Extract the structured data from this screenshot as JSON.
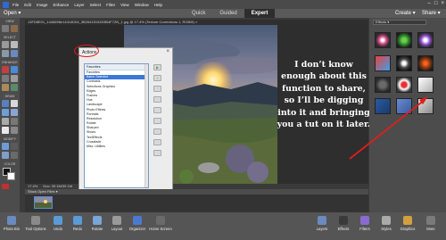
{
  "menubar": {
    "items": [
      "File",
      "Edit",
      "Image",
      "Enhance",
      "Layer",
      "Select",
      "Filter",
      "View",
      "Window",
      "Help"
    ],
    "window_controls": [
      "–",
      "□",
      "×"
    ]
  },
  "modebar": {
    "open_label": "Open ▾",
    "tabs": [
      "Quick",
      "Guided",
      "Expert"
    ],
    "active_tab": "Expert",
    "create_label": "Create ▾",
    "share_label": "Share ▾"
  },
  "tools": {
    "sections": [
      "VIEW",
      "SELECT",
      "ENHANCE",
      "DRAW",
      "MODIFY",
      "COLOR"
    ]
  },
  "document": {
    "tab_title": "13FD8E01_1446696e14414D04_3B26415151E8B4F7ZN_1.jpg @ 17.4% (Texture Corrections 1, RGB/8) ×",
    "status_zoom": "17.4%",
    "status_doc": "Doc: 39.1M/39.1M"
  },
  "annotation": {
    "text": "I don’t know enough about this function to share, so I’ll be digging into it and bringing you a tut on it later."
  },
  "dialog": {
    "title": "Actions",
    "list_header": "Favorites",
    "items": [
      "Favorites",
      "Batch Selected",
      "Contrasts",
      "Selections Graphics",
      "Edges",
      "Frames",
      "Hue",
      "Landscape",
      "Photo Effects",
      "Portraits",
      "Resolution",
      "Rotate",
      "Sharpen",
      "Shoes",
      "TextEffects",
      "Crossfade",
      "Misc. Utilities"
    ],
    "selected_index": 1,
    "checkbox_1": "Loc. ation",
    "checkbox_2": "Selection Report",
    "close_label": "Close"
  },
  "photo_bin": {
    "label": "Show Open Files ▾"
  },
  "right_panel": {
    "header": "Effects ▾"
  },
  "bottombar": {
    "left_items": [
      "Photo Bin",
      "Tool Options",
      "Undo",
      "Redo",
      "Rotate",
      "Layout",
      "Organizer",
      "Home Screen"
    ],
    "right_items": [
      "Layers",
      "Effects",
      "Filters",
      "Styles",
      "Graphics",
      "More"
    ]
  },
  "colors": {
    "annotation_red": "#e21c1c",
    "selection_blue": "#3b78d8",
    "ui_dark": "#3a3a3a"
  }
}
